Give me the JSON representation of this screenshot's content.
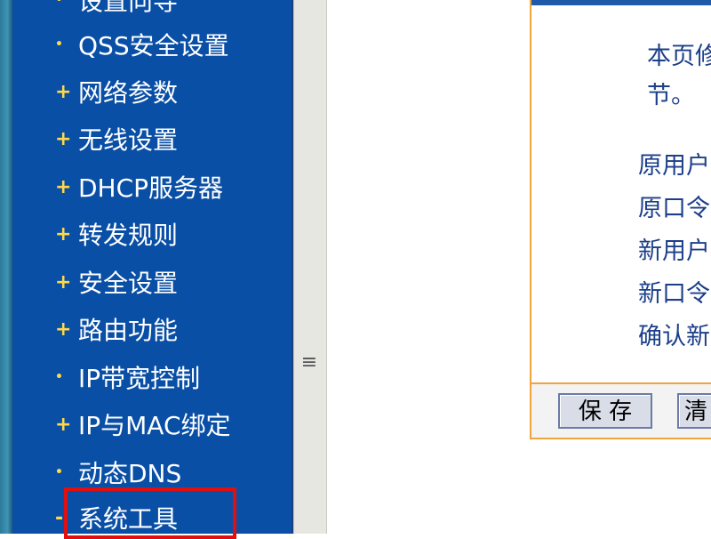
{
  "sidebar": {
    "items": [
      {
        "bullet": "•",
        "label": "设置向导"
      },
      {
        "bullet": "•",
        "label": "QSS安全设置"
      },
      {
        "bullet": "+",
        "label": "网络参数"
      },
      {
        "bullet": "+",
        "label": "无线设置"
      },
      {
        "bullet": "+",
        "label": "DHCP服务器"
      },
      {
        "bullet": "+",
        "label": "转发规则"
      },
      {
        "bullet": "+",
        "label": "安全设置"
      },
      {
        "bullet": "+",
        "label": "路由功能"
      },
      {
        "bullet": "•",
        "label": "IP带宽控制"
      },
      {
        "bullet": "+",
        "label": "IP与MAC绑定"
      },
      {
        "bullet": "•",
        "label": "动态DNS"
      },
      {
        "bullet": "-",
        "label": "系统工具"
      }
    ],
    "highlighted_item": "系统工具",
    "highlight_color": "#e01010",
    "background_color": "#0a4fa6"
  },
  "splitter": {
    "grip_icon": "≡"
  },
  "content": {
    "intro_line1": "本页修",
    "intro_line2": "节。",
    "fields": [
      {
        "label": "原用户"
      },
      {
        "label": "原口令"
      },
      {
        "label": "新用户"
      },
      {
        "label": "新口令"
      },
      {
        "label": "确认新"
      }
    ],
    "buttons": {
      "save": "保 存",
      "clear": "清"
    },
    "border_color": "#f0a43c",
    "text_color": "#1c3f8a"
  }
}
